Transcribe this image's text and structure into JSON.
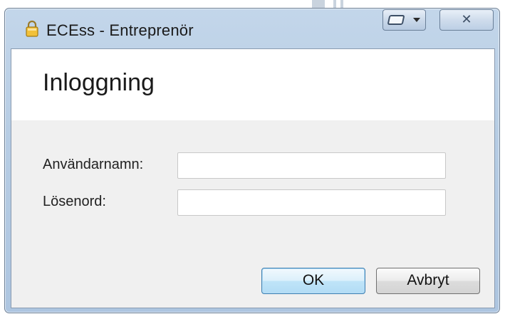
{
  "window": {
    "title": "ECEss - Entreprenör",
    "close_glyph": "✕",
    "icon": "lock-icon",
    "restore_icon": "restore-icon",
    "dropdown_icon": "caret-down-icon"
  },
  "header": {
    "title": "Inloggning"
  },
  "form": {
    "username_label": "Användarnamn:",
    "username_value": "",
    "password_label": "Lösenord:",
    "password_value": ""
  },
  "buttons": {
    "ok_label": "OK",
    "cancel_label": "Avbryt"
  },
  "colors": {
    "frame": "#b7cde4",
    "ok_border": "#3c7fb1"
  }
}
